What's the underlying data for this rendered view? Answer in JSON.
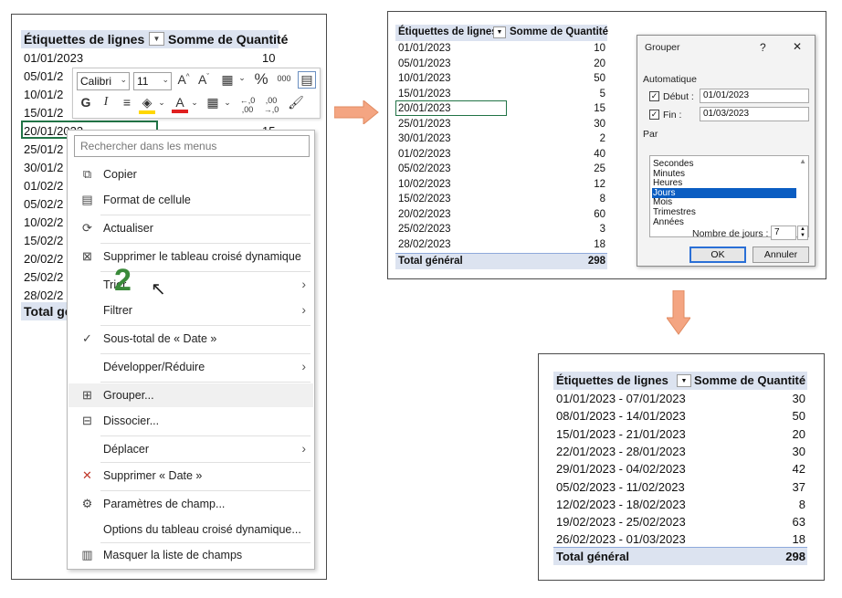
{
  "pivot_headers": {
    "row_labels": "Étiquettes de lignes",
    "sum_qty": "Somme de Quantité"
  },
  "dates": [
    {
      "date": "01/01/2023",
      "qty": "10"
    },
    {
      "date": "05/01/2023",
      "qty": "20"
    },
    {
      "date": "10/01/2023",
      "qty": "50"
    },
    {
      "date": "15/01/2023",
      "qty": "5"
    },
    {
      "date": "20/01/2023",
      "qty": "15"
    },
    {
      "date": "25/01/2023",
      "qty": "30"
    },
    {
      "date": "30/01/2023",
      "qty": "2"
    },
    {
      "date": "01/02/2023",
      "qty": "40"
    },
    {
      "date": "05/02/2023",
      "qty": "25"
    },
    {
      "date": "10/02/2023",
      "qty": "12"
    },
    {
      "date": "15/02/2023",
      "qty": "8"
    },
    {
      "date": "20/02/2023",
      "qty": "60"
    },
    {
      "date": "25/02/2023",
      "qty": "3"
    },
    {
      "date": "28/02/2023",
      "qty": "18"
    }
  ],
  "panel1": {
    "visible_dates": [
      "01/01/2023",
      "05/01/2",
      "10/01/2",
      "15/01/2",
      "20/01/2023",
      "25/01/2",
      "30/01/2",
      "01/02/2",
      "05/02/2",
      "10/02/2",
      "15/02/2",
      "20/02/2",
      "25/02/2",
      "28/02/2"
    ],
    "val_01": "10",
    "val_20": "15",
    "total_partial": "Total géné"
  },
  "total": {
    "label": "Total général",
    "value": "298"
  },
  "mini_toolbar": {
    "font_name": "Calibri",
    "font_size": "11",
    "bold": "G",
    "italic": "I",
    "percent": "%",
    "thousands": "000"
  },
  "context_menu": {
    "search_placeholder": "Rechercher dans les menus",
    "items": {
      "copy": "Copier",
      "format": "Format de cellule",
      "refresh": "Actualiser",
      "delete_pivot": "Supprimer le tableau croisé dynamique",
      "sort": "Trier",
      "filter": "Filtrer",
      "subtotal": "Sous-total de « Date »",
      "expand": "Développer/Réduire",
      "group": "Grouper...",
      "ungroup": "Dissocier...",
      "move": "Déplacer",
      "remove_field": "Supprimer « Date »",
      "field_settings": "Paramètres de champ...",
      "pivot_options": "Options du tableau croisé dynamique...",
      "hide_field_list": "Masquer la liste de champs"
    },
    "step_number": "2"
  },
  "dialog": {
    "title": "Grouper",
    "help": "?",
    "close": "✕",
    "auto_label": "Automatique",
    "start_label": "Début :",
    "start_value": "01/01/2023",
    "end_label": "Fin :",
    "end_value": "01/03/2023",
    "by_label": "Par",
    "units": [
      "Secondes",
      "Minutes",
      "Heures",
      "Jours",
      "Mois",
      "Trimestres",
      "Années"
    ],
    "selected_unit": "Jours",
    "days_label": "Nombre de jours :",
    "days_value": "7",
    "ok": "OK",
    "cancel": "Annuler"
  },
  "weeks": [
    {
      "range": "01/01/2023 - 07/01/2023",
      "qty": "30"
    },
    {
      "range": "08/01/2023 - 14/01/2023",
      "qty": "50"
    },
    {
      "range": "15/01/2023 - 21/01/2023",
      "qty": "20"
    },
    {
      "range": "22/01/2023 - 28/01/2023",
      "qty": "30"
    },
    {
      "range": "29/01/2023 - 04/02/2023",
      "qty": "42"
    },
    {
      "range": "05/02/2023 - 11/02/2023",
      "qty": "37"
    },
    {
      "range": "12/02/2023 - 18/02/2023",
      "qty": "8"
    },
    {
      "range": "19/02/2023 - 25/02/2023",
      "qty": "63"
    },
    {
      "range": "26/02/2023 - 01/03/2023",
      "qty": "18"
    }
  ],
  "colors": {
    "accent_green": "#217346",
    "header_blue": "#dce3f0",
    "arrow_orange": "#f4a582",
    "selection": "#0a5dc2"
  }
}
